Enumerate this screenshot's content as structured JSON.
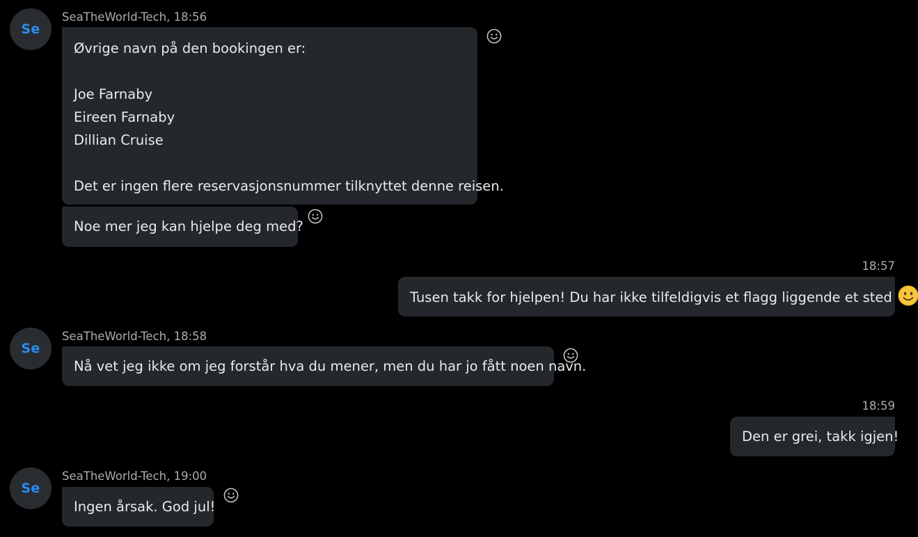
{
  "messages": [
    {
      "sender_avatar": "Se",
      "header": "SeaTheWorld-Tech, 18:56",
      "bubbles": [
        {
          "lines": [
            "Øvrige navn på den bookingen er:",
            "",
            "Joe Farnaby",
            "Eireen Farnaby",
            "Dillian Cruise",
            "",
            "Det er ingen flere reservasjonsnummer tilknyttet denne reisen."
          ]
        },
        {
          "lines": [
            "Noe mer jeg kan hjelpe deg med?"
          ]
        }
      ]
    },
    {
      "outgoing": true,
      "time": "18:57",
      "text_before_emoji": "Tusen takk for hjelpen! Du har ikke tilfeldigvis et flagg liggende et sted",
      "emoji": "smiley-emoji",
      "text_after_emoji": "?"
    },
    {
      "sender_avatar": "Se",
      "header": "SeaTheWorld-Tech, 18:58",
      "text": "Nå vet jeg ikke om jeg forstår hva du mener, men du har jo fått noen navn."
    },
    {
      "outgoing": true,
      "time": "18:59",
      "text": "Den er grei, takk igjen!"
    },
    {
      "sender_avatar": "Se",
      "header": "SeaTheWorld-Tech, 19:00",
      "text": "Ingen årsak. God jul!"
    }
  ],
  "icons": {
    "reaction": "add-reaction-smiley-icon"
  },
  "colors": {
    "background": "#000000",
    "bubble": "#24272b",
    "avatar_bg": "#292d32",
    "avatar_text": "#2b8cf0",
    "meta_text": "#a8adb2",
    "body_text": "#e9ebed",
    "emoji": "#f6c53b"
  }
}
